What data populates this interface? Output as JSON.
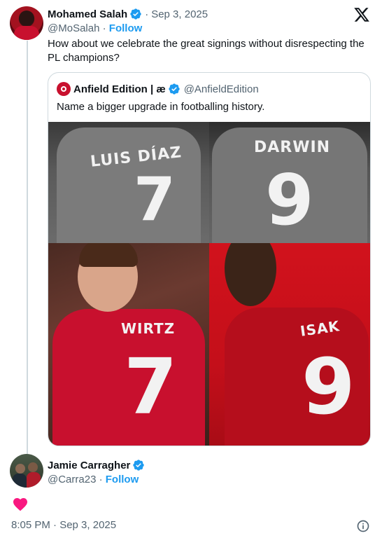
{
  "tweet": {
    "author_name": "Mohamed Salah",
    "handle": "@MoSalah",
    "separator": "·",
    "date": "Sep 3, 2025",
    "follow_label": "Follow",
    "text": "How about we celebrate the great signings without disrespecting the PL champions?"
  },
  "quote": {
    "author_name": "Anfield Edition | æ",
    "handle": "@AnfieldEdition",
    "text": "Name a bigger upgrade in footballing history.",
    "jerseys": {
      "diaz": {
        "name": "LUIS DÍAZ",
        "number": "7"
      },
      "darwin": {
        "name": "DARWIN",
        "number": "9"
      },
      "wirtz": {
        "name": "WIRTZ",
        "number": "7"
      },
      "isak": {
        "name": "ISAK",
        "number": "9"
      }
    }
  },
  "reply": {
    "author_name": "Jamie Carragher",
    "handle": "@Carra23",
    "separator": "·",
    "follow_label": "Follow",
    "reaction": "heart-icon"
  },
  "footer": {
    "timestamp": "8:05 PM · Sep 3, 2025"
  },
  "colors": {
    "link": "#1d9bf0",
    "verified": "#1d9bf0",
    "secondary_text": "#536471",
    "heart": "#f91880"
  }
}
